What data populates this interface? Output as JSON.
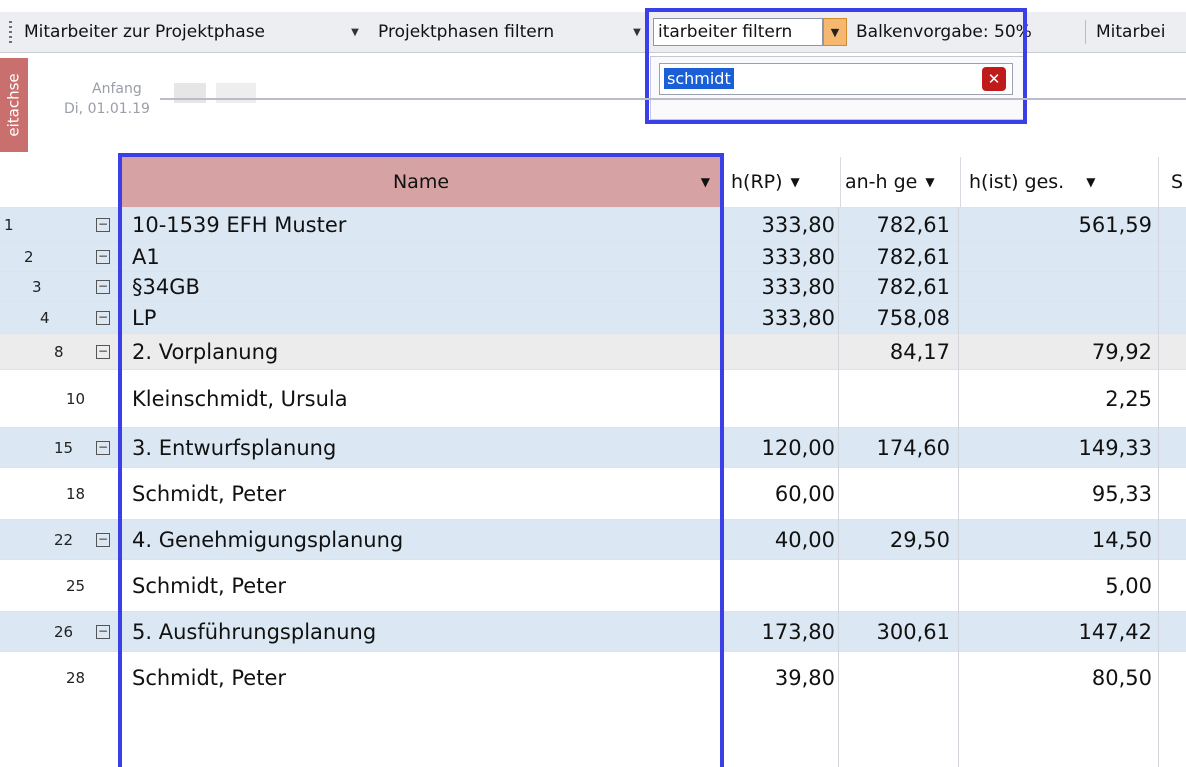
{
  "toolbar": {
    "item1": "Mitarbeiter zur Projektphase",
    "item2": "Projektphasen filtern",
    "filter_label": "itarbeiter filtern",
    "item4": "Balkenvorgabe: 50%",
    "item5": "Mitarbei"
  },
  "filter_popup": {
    "value": "schmidt"
  },
  "timeline": {
    "tab_label": "eitachse",
    "anfang": "Anfang",
    "datum": "Di, 01.01.19"
  },
  "grid": {
    "columns": {
      "name": "Name",
      "c1": "h(RP)",
      "c2": "an-h ge",
      "c3": "h(ist) ges.",
      "c4": "S"
    },
    "rows": [
      {
        "n": "1",
        "name": "10-1539 EFH Muster",
        "c1": "333,80",
        "c2": "782,61",
        "c3": "561,59"
      },
      {
        "n": "2",
        "name": "A1",
        "c1": "333,80",
        "c2": "782,61",
        "c3": ""
      },
      {
        "n": "3",
        "name": "§34GB",
        "c1": "333,80",
        "c2": "782,61",
        "c3": ""
      },
      {
        "n": "4",
        "name": "LP",
        "c1": "333,80",
        "c2": "758,08",
        "c3": ""
      },
      {
        "n": "8",
        "name": "2. Vorplanung",
        "c1": "",
        "c2": "84,17",
        "c3": "79,92"
      },
      {
        "n": "10",
        "name": "Kleinschmidt, Ursula",
        "c1": "",
        "c2": "",
        "c3": "2,25"
      },
      {
        "n": "15",
        "name": "3. Entwurfsplanung",
        "c1": "120,00",
        "c2": "174,60",
        "c3": "149,33"
      },
      {
        "n": "18",
        "name": "Schmidt, Peter",
        "c1": "60,00",
        "c2": "",
        "c3": "95,33"
      },
      {
        "n": "22",
        "name": "4. Genehmigungsplanung",
        "c1": "40,00",
        "c2": "29,50",
        "c3": "14,50"
      },
      {
        "n": "25",
        "name": "Schmidt, Peter",
        "c1": "",
        "c2": "",
        "c3": "5,00"
      },
      {
        "n": "26",
        "name": "5. Ausführungsplanung",
        "c1": "173,80",
        "c2": "300,61",
        "c3": "147,42"
      },
      {
        "n": "28",
        "name": "Schmidt, Peter",
        "c1": "39,80",
        "c2": "",
        "c3": "80,50"
      }
    ]
  }
}
